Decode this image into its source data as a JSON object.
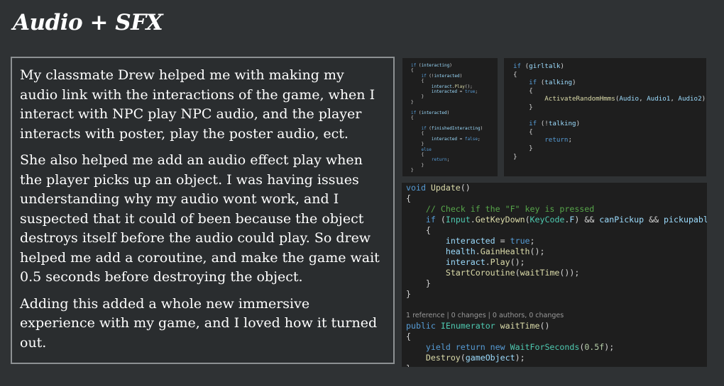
{
  "title": "Audio + SFX",
  "text_panel": {
    "paragraphs": [
      "My classmate Drew helped me with making my audio link with the interactions of the game, when I interact with NPC play NPC audio, and the player interacts with poster, play the poster audio, ect.",
      "She also helped me add an audio effect play when the player picks up an object. I was having issues understanding why my audio wont work, and I suspected that it could of been because the object destroys itself before the audio could play. So drew helped me add a coroutine, and make the game wait 0.5 seconds before destroying the object.",
      "Adding this added a whole new immersive experience with my game, and I loved how it turned out."
    ]
  },
  "code_snippets": [
    {
      "lines": [
        "if (interacting)",
        "{",
        "    if (!interacted)",
        "    {",
        "        interact.Play();",
        "        interacted = true;",
        "    }",
        "}",
        "if (interacted)",
        "{",
        "    if (finishedInteracting)",
        "    {",
        "        interacted = false;",
        "    }",
        "    else",
        "    {",
        "        return;",
        "    }",
        "}"
      ]
    },
    {
      "lines": [
        "if (girltalk)",
        "{",
        "    if (talking)",
        "    {",
        "        ActivateRandomHmms(Audio, Audio1, Audio2);",
        "    }",
        "",
        "    if (!talking)",
        "    {",
        "        return;",
        "    }",
        "}"
      ]
    },
    {
      "lines": [
        "void Update()",
        "{",
        "    // Check if the \"F\" key is pressed",
        "    if (Input.GetKeyDown(KeyCode.F) && canPickup && pickupable)",
        "    {",
        "        interacted = true;",
        "        health.GainHealth();",
        "        interact.Play();",
        "        StartCoroutine(waitTime());",
        "    }",
        "}",
        "",
        "1 reference | 0 changes | 0 authors, 0 changes",
        "public IEnumerator waitTime()",
        "{",
        "    yield return new WaitForSeconds(0.5f);",
        "    Destroy(gameObject);",
        "}"
      ]
    }
  ],
  "colors": {
    "background": "#2f3234",
    "panel_border": "#8d9193",
    "code_bg": "#1e1e1e"
  }
}
